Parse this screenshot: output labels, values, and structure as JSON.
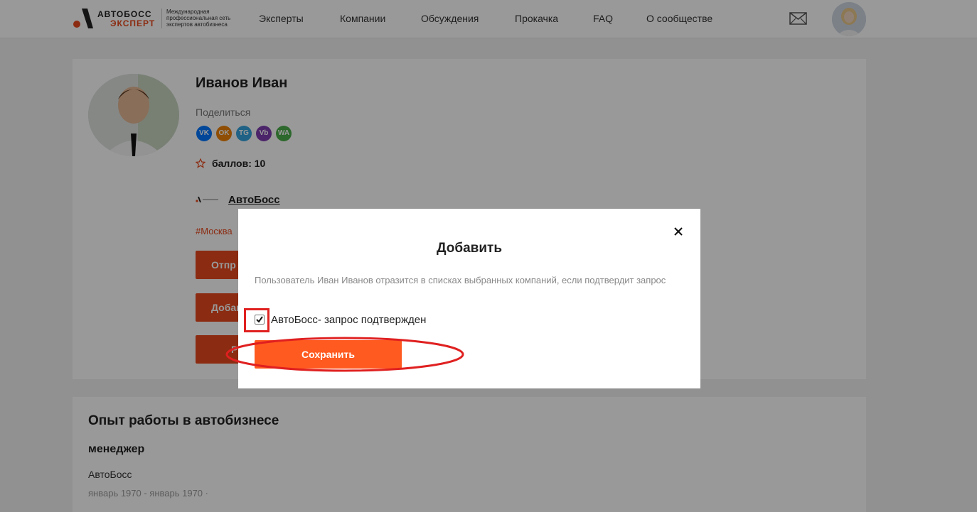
{
  "header": {
    "logo_word1": "АВТОБОСС",
    "logo_word2": "ЭКСПЕРТ",
    "logo_tagline": "Международная профессиональная сеть экспертов автобизнеса",
    "nav": [
      "Эксперты",
      "Компании",
      "Обсуждения",
      "Прокачка",
      "FAQ",
      "О сообществе"
    ],
    "mail_icon": "mail-icon"
  },
  "profile": {
    "name": "Иванов Иван",
    "share_label": "Поделиться",
    "social": [
      {
        "label": "VK",
        "color": "#0077ff",
        "icon": "vk-icon"
      },
      {
        "label": "OK",
        "color": "#ee8208",
        "icon": "odnoklassniki-icon"
      },
      {
        "label": "TG",
        "color": "#34a3de",
        "icon": "telegram-icon"
      },
      {
        "label": "Vb",
        "color": "#7d3daf",
        "icon": "viber-icon"
      },
      {
        "label": "WA",
        "color": "#4cae4c",
        "icon": "whatsapp-icon"
      }
    ],
    "points": "баллов: 10",
    "company": "АвтоБосс",
    "tag": "#Москва",
    "buttons": [
      "Отпр",
      "Добав",
      "Р"
    ]
  },
  "experience": {
    "title": "Опыт работы в автобизнесе",
    "role": "менеджер",
    "company": "АвтоБосс",
    "dates": "январь 1970 - январь 1970 ·"
  },
  "modal": {
    "title": "Добавить",
    "description": "Пользователь Иван Иванов отразится в списках выбранных компаний, если подтвердит запрос",
    "checkbox_label": "АвтоБосс- запрос подтвержден",
    "checkbox_checked": true,
    "save_label": "Сохранить"
  },
  "colors": {
    "accent": "#e8491d",
    "save_button": "#ff5a1f",
    "highlight": "#e02020"
  }
}
